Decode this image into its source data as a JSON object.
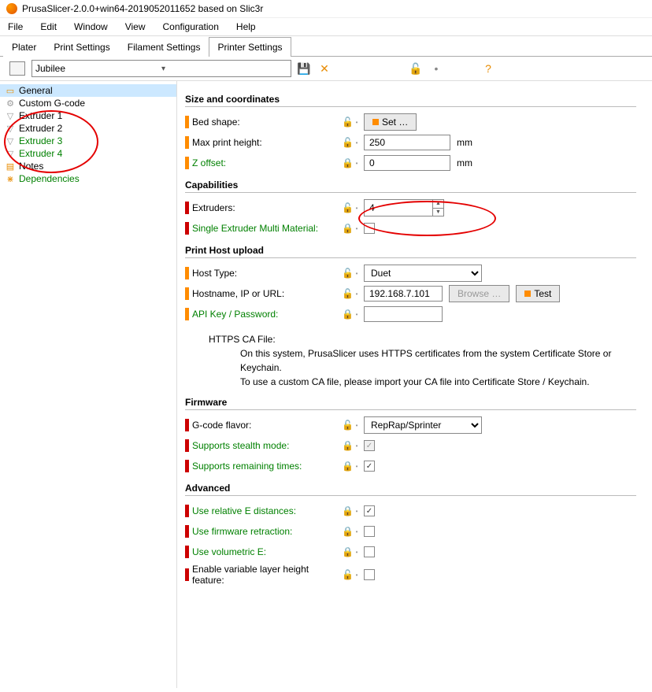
{
  "window_title": "PrusaSlicer-2.0.0+win64-2019052011652 based on Slic3r",
  "menus": [
    "File",
    "Edit",
    "Window",
    "View",
    "Configuration",
    "Help"
  ],
  "tabs": [
    "Plater",
    "Print Settings",
    "Filament Settings",
    "Printer Settings"
  ],
  "active_tab": 3,
  "preset_name": "Jubilee",
  "toolbar_icons": {
    "lock": "🔓",
    "question": "?"
  },
  "tree": [
    {
      "icon": "printer",
      "label": "General",
      "selected": true
    },
    {
      "icon": "gear",
      "label": "Custom G-code"
    },
    {
      "icon": "extruder",
      "label": "Extruder 1"
    },
    {
      "icon": "extruder",
      "label": "Extruder 2"
    },
    {
      "icon": "extruder",
      "label": "Extruder 3",
      "class": "green"
    },
    {
      "icon": "extruder",
      "label": "Extruder 4",
      "class": "green"
    },
    {
      "icon": "notes",
      "label": "Notes"
    },
    {
      "icon": "dep",
      "label": "Dependencies",
      "class": "green"
    }
  ],
  "sections": {
    "size": {
      "title": "Size and coordinates",
      "bed_shape": {
        "label": "Bed shape:",
        "button": "Set …",
        "lock": "open"
      },
      "max_print_height": {
        "label": "Max print height:",
        "value": "250",
        "unit": "mm",
        "lock": "open"
      },
      "z_offset": {
        "label": "Z offset:",
        "value": "0",
        "unit": "mm",
        "lock": "closed",
        "class": "green"
      }
    },
    "capabilities": {
      "title": "Capabilities",
      "extruders": {
        "label": "Extruders:",
        "value": "4",
        "lock": "open"
      },
      "single_mm": {
        "label": "Single Extruder Multi Material:",
        "checked": false,
        "lock": "closed",
        "class": "green"
      }
    },
    "print_host": {
      "title": "Print Host upload",
      "host_type": {
        "label": "Host Type:",
        "value": "Duet",
        "lock": "open"
      },
      "hostname": {
        "label": "Hostname, IP or URL:",
        "value": "192.168.7.101",
        "lock": "open",
        "browse": "Browse …",
        "test": "Test"
      },
      "api_key": {
        "label": "API Key / Password:",
        "value": "",
        "lock": "closed",
        "class": "green"
      },
      "https_title": "HTTPS CA File:",
      "https_line1": "On this system, PrusaSlicer uses HTTPS certificates from the system Certificate Store or Keychain.",
      "https_line2": "To use a custom CA file, please import your CA file into Certificate Store / Keychain."
    },
    "firmware": {
      "title": "Firmware",
      "flavor": {
        "label": "G-code flavor:",
        "value": "RepRap/Sprinter",
        "lock": "open"
      },
      "stealth": {
        "label": "Supports stealth mode:",
        "checked": true,
        "disabled": true,
        "lock": "closed",
        "class": "green"
      },
      "remaining": {
        "label": "Supports remaining times:",
        "checked": true,
        "lock": "closed",
        "class": "green"
      }
    },
    "advanced": {
      "title": "Advanced",
      "rel_e": {
        "label": "Use relative E distances:",
        "checked": true,
        "lock": "closed",
        "class": "green"
      },
      "fw_retract": {
        "label": "Use firmware retraction:",
        "checked": false,
        "lock": "closed",
        "class": "green"
      },
      "vol_e": {
        "label": "Use volumetric E:",
        "checked": false,
        "lock": "closed",
        "class": "green"
      },
      "var_layer": {
        "label": "Enable variable layer height feature:",
        "checked": false,
        "lock": "open"
      }
    }
  }
}
